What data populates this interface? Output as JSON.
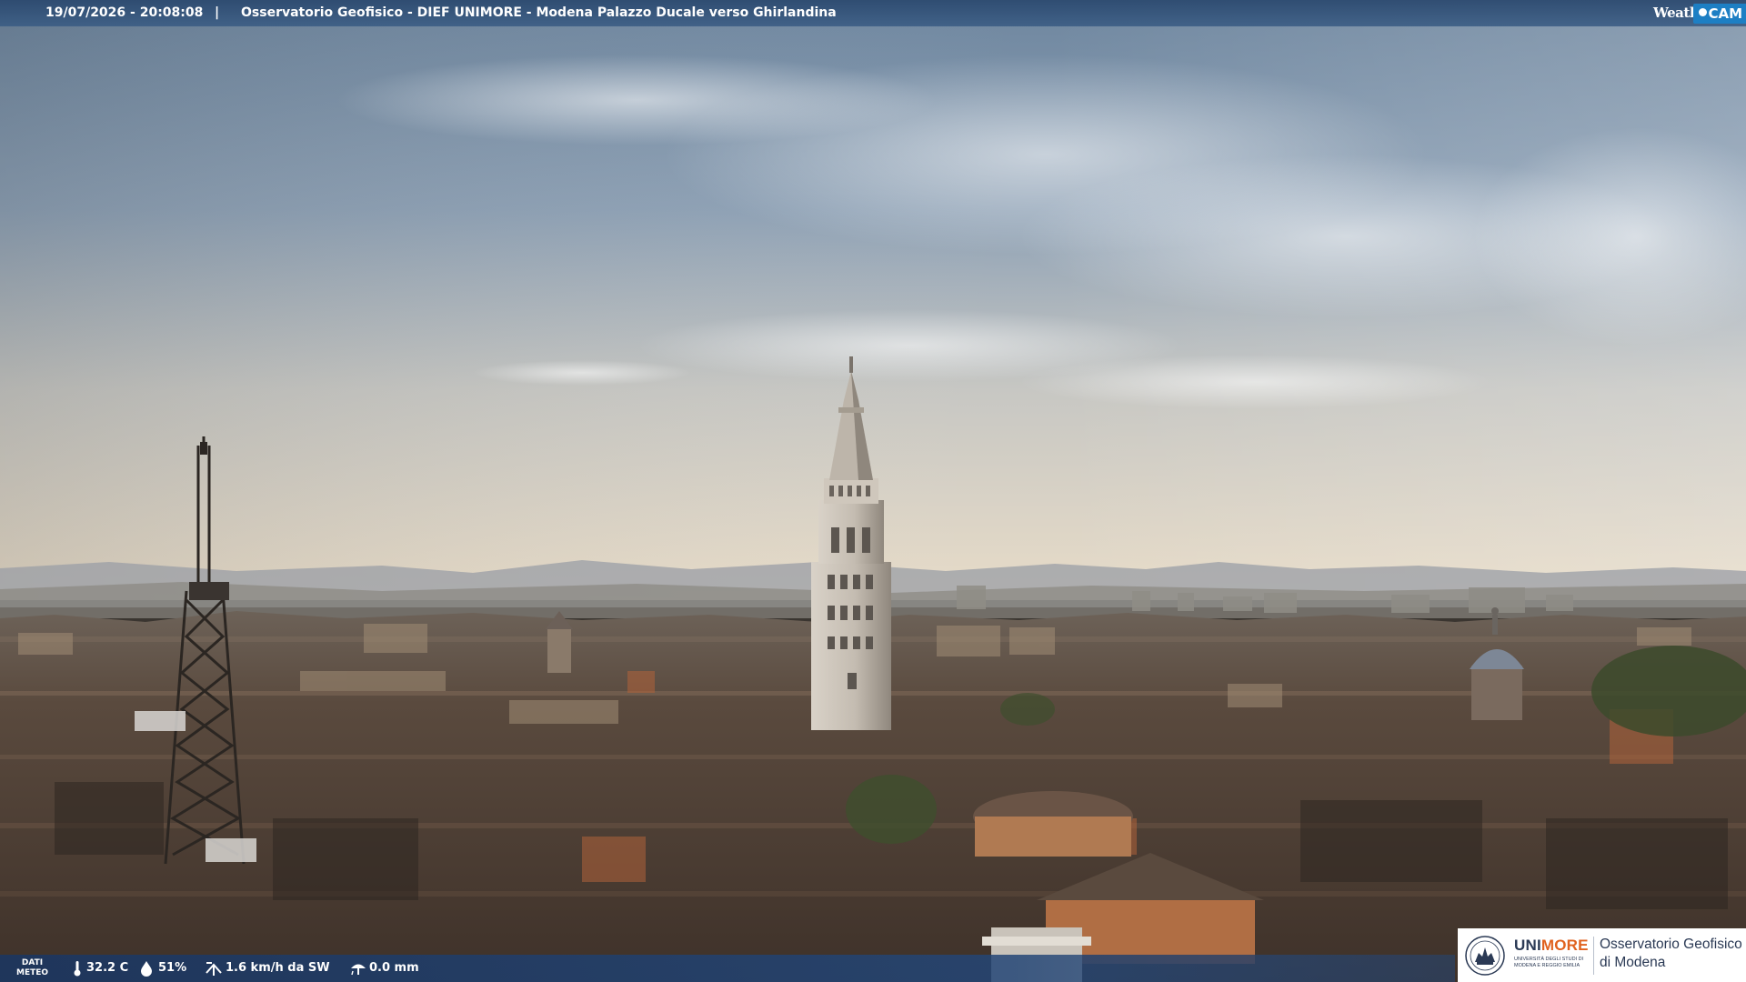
{
  "header": {
    "timestamp": "19/07/2026 - 20:08:08",
    "separator": "|",
    "camera_title": "Osservatorio Geofisico - DIEF UNIMORE - Modena Palazzo Ducale verso Ghirlandina"
  },
  "logo_weathercam": {
    "word1": "Weather",
    "word2": "CAM"
  },
  "meteo": {
    "label_line1": "DATI",
    "label_line2": "METEO",
    "temperature": "32.2 C",
    "humidity": "51%",
    "wind": "1.6 km/h da SW",
    "rain": "0.0 mm"
  },
  "logo_unimore": {
    "uni_part1": "UNI",
    "uni_part2": "MORE",
    "uni_subtitle": "UNIVERSITÀ DEGLI STUDI DI MODENA E REGGIO EMILIA",
    "observatory_line1": "Osservatorio Geofisico",
    "observatory_line2": "di Modena"
  },
  "colors": {
    "sky_top": "#6b849e",
    "sky_horizon": "#e6dccb",
    "roofs": "#4a3a30",
    "bar_blue": "#2a4a78",
    "unimore_orange": "#e0621f"
  },
  "icons": [
    "thermometer-icon",
    "humidity-drop-icon",
    "wind-icon",
    "rain-icon",
    "unimore-seal-icon"
  ]
}
